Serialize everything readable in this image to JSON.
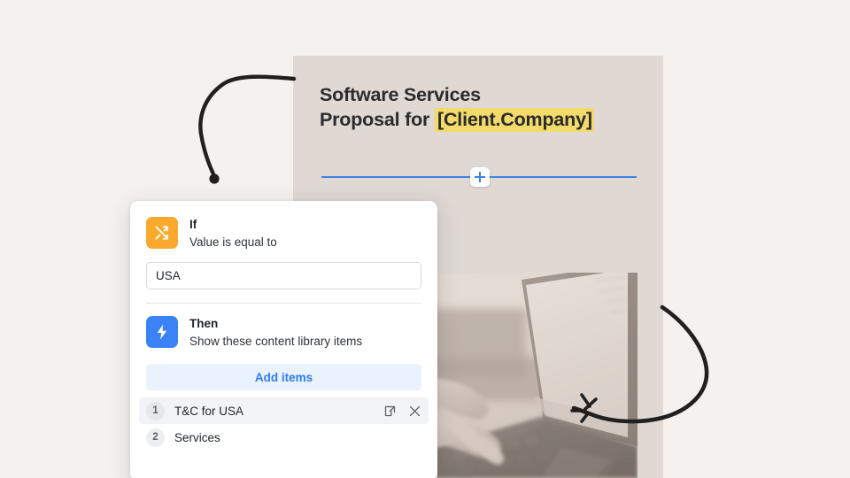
{
  "canvas": {
    "background_color": "#F4F1EE"
  },
  "document_preview": {
    "background_color": "#DFD8D3",
    "title_line1": "Software Services",
    "title_line2_prefix": "Proposal for ",
    "title_token": "[Client.Company]",
    "highlight_color": "#F2DA6B",
    "insert_divider": {
      "line_color": "#3B82E0",
      "add_button_label": "+"
    },
    "photo_alt": "hands typing on a laptop keyboard"
  },
  "decorations": {
    "arrow_left_name": "hand-drawn-curved-arrow-left",
    "arrow_right_name": "hand-drawn-curved-arrow-right",
    "sparkle_name": "hand-drawn-sparkle"
  },
  "logic_card": {
    "if_section": {
      "icon": "shuffle-icon",
      "icon_color": "#FBA92C",
      "label": "If",
      "description": "Value is equal to",
      "value_input": {
        "value": "USA",
        "placeholder": "Enter a value"
      }
    },
    "then_section": {
      "icon": "lightning-bolt-icon",
      "icon_color": "#3B82F6",
      "label": "Then",
      "description": "Show these content library items"
    },
    "add_items_label": "Add items",
    "add_items_color": "#2B7CF0",
    "items": [
      {
        "number": "1",
        "label": "T&C for USA",
        "active": true
      },
      {
        "number": "2",
        "label": "Services",
        "active": false
      }
    ]
  }
}
